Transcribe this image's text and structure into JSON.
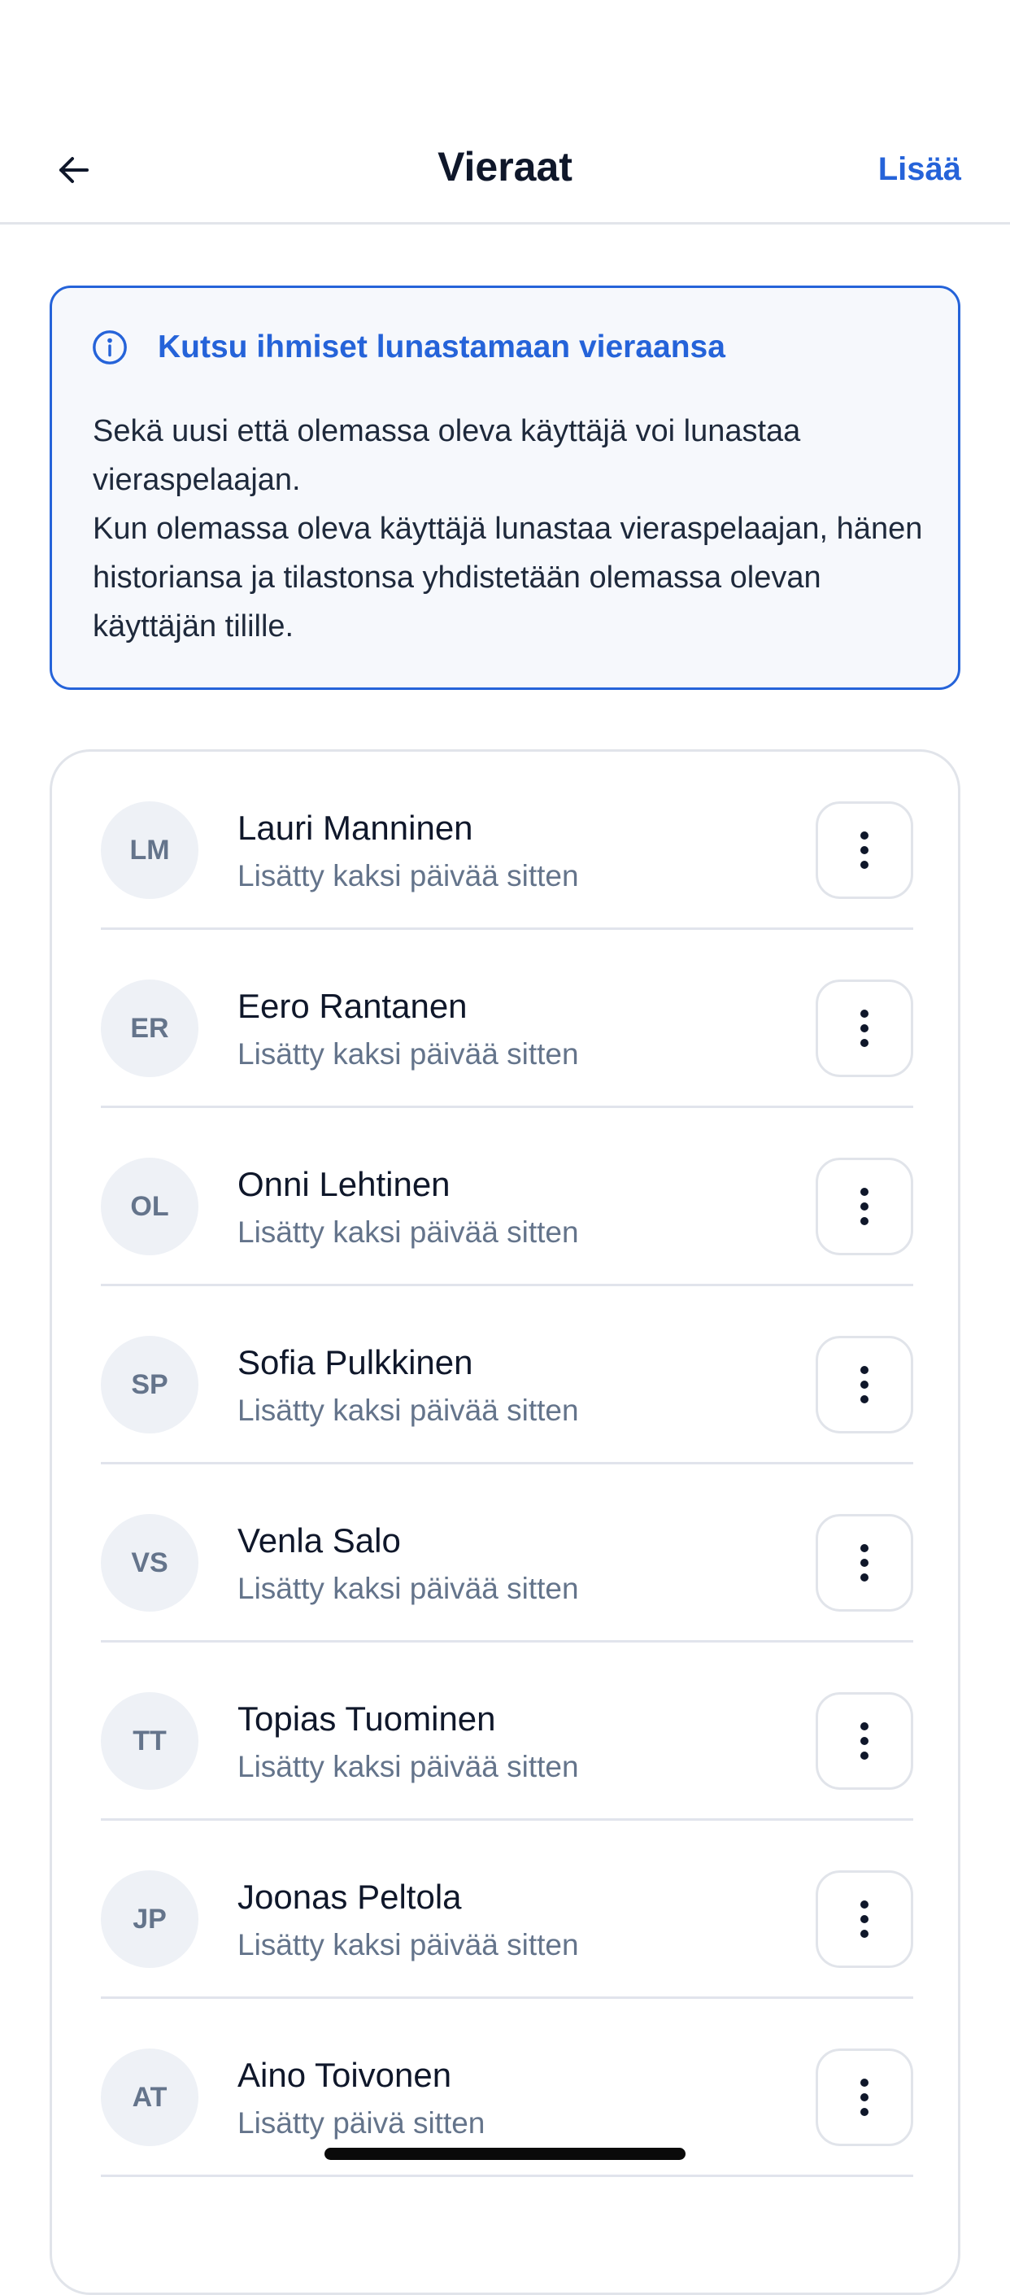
{
  "header": {
    "title": "Vieraat",
    "add_label": "Lisää"
  },
  "info": {
    "title": "Kutsu ihmiset lunastamaan vieraansa",
    "paragraph1": "Sekä uusi että olemassa oleva käyttäjä voi lunastaa vieraspelaajan.",
    "paragraph2": "Kun olemassa oleva käyttäjä lunastaa vieraspelaajan, hänen historiansa ja tilastonsa yhdistetään olemassa olevan käyttäjän tilille."
  },
  "guests": [
    {
      "initials": "LM",
      "name": "Lauri Manninen",
      "added": "Lisätty kaksi päivää sitten"
    },
    {
      "initials": "ER",
      "name": "Eero Rantanen",
      "added": "Lisätty kaksi päivää sitten"
    },
    {
      "initials": "OL",
      "name": "Onni Lehtinen",
      "added": "Lisätty kaksi päivää sitten"
    },
    {
      "initials": "SP",
      "name": "Sofia Pulkkinen",
      "added": "Lisätty kaksi päivää sitten"
    },
    {
      "initials": "VS",
      "name": "Venla Salo",
      "added": "Lisätty kaksi päivää sitten"
    },
    {
      "initials": "TT",
      "name": "Topias Tuominen",
      "added": "Lisätty kaksi päivää sitten"
    },
    {
      "initials": "JP",
      "name": "Joonas Peltola",
      "added": "Lisätty kaksi päivää sitten"
    },
    {
      "initials": "AT",
      "name": "Aino Toivonen",
      "added": "Lisätty päivä sitten"
    }
  ],
  "colors": {
    "accent": "#2563d9",
    "text": "#0f172a",
    "muted": "#64748b",
    "info_background": "#f6f8fc",
    "avatar_background": "#eef1f6",
    "border": "#e1e4ea"
  },
  "icons": {
    "back": "arrow-left-icon",
    "info": "info-circle-icon",
    "more": "more-vertical-icon"
  }
}
